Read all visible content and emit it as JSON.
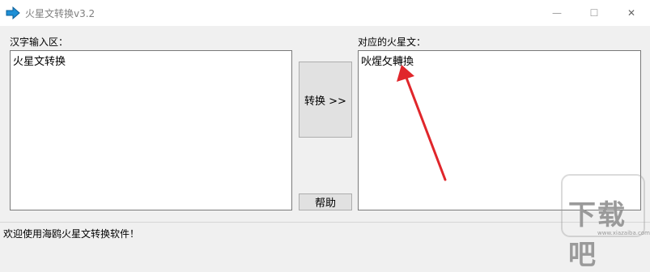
{
  "window": {
    "title": "火星文转换v3.2",
    "minimize_glyph": "—",
    "maximize_glyph": "☐",
    "close_glyph": "✕"
  },
  "left_panel": {
    "label": "汉字输入区：",
    "value": "火星文转换"
  },
  "right_panel": {
    "label": "对应的火星文：",
    "value": "吙煋攵轉換"
  },
  "buttons": {
    "convert_label": "转换 >>",
    "help_label": "帮助"
  },
  "status": {
    "text": "欢迎使用海鸥火星文转换软件！"
  },
  "watermark": {
    "text": "下载吧",
    "sub": "www.xiazaiba.com"
  },
  "colors": {
    "annotation_arrow": "#e0262b",
    "app_icon": "#1e8fd6"
  }
}
